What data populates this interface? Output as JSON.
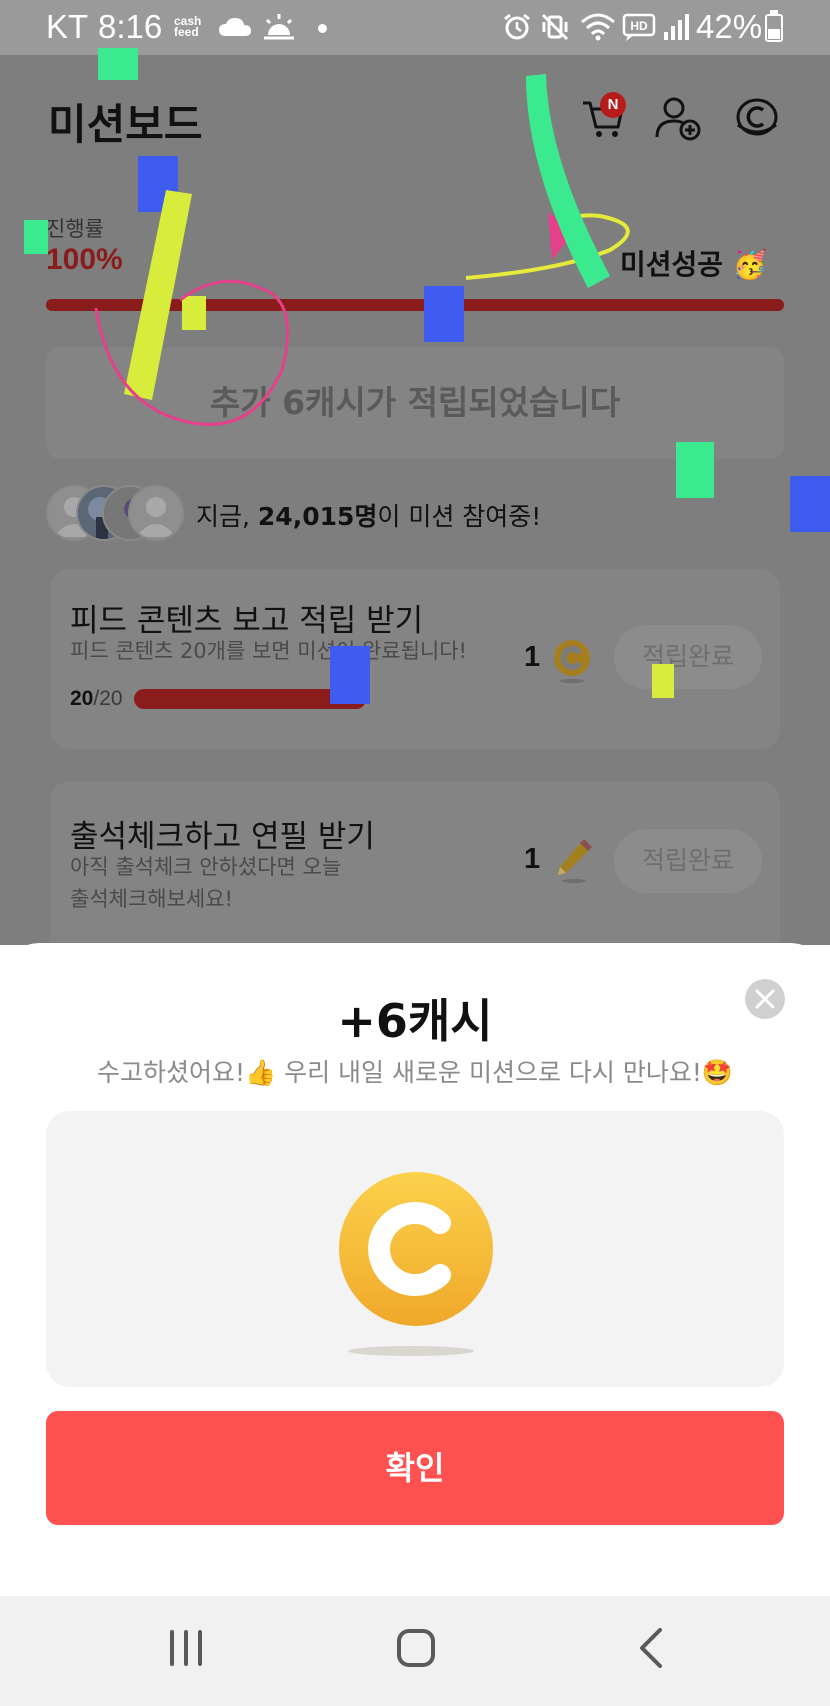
{
  "status_bar": {
    "carrier": "KT",
    "time": "8:16",
    "app_logo_line1": "cash",
    "app_logo_line2": "feed",
    "battery": "42%",
    "icons": [
      "cloud-icon",
      "sunrise-icon",
      "alarm-icon",
      "vibrate-icon",
      "wifi-icon",
      "hd-voice-icon",
      "signal-icon",
      "battery-icon"
    ]
  },
  "header": {
    "title": "미션보드",
    "cart_badge": "N",
    "icons": [
      "cart-icon",
      "add-friend-icon",
      "cash-coin-icon"
    ]
  },
  "progress": {
    "label": "진행률",
    "value_text": "100%",
    "value": 1.0,
    "success_text": "미션성공",
    "success_emoji": "🥳"
  },
  "bonus_banner": {
    "text": "추가 6캐시가 적립되었습니다"
  },
  "participants": {
    "prefix": "지금, ",
    "count": "24,015명",
    "suffix": "이 미션 참여중!"
  },
  "missions": [
    {
      "title": "피드 콘텐츠 보고 적립 받기",
      "desc": "피드 콘텐츠 20개를 보면 미션이 완료됩니다!",
      "reward": "1",
      "reward_icon": "cash-coin-icon",
      "progress_done": "20",
      "progress_total": "/20",
      "progress": 1.0,
      "button": "적립완료"
    },
    {
      "title": "출석체크하고 연필 받기",
      "desc_line1": "아직 출석체크 안하셨다면 오늘",
      "desc_line2": "출석체크해보세요!",
      "reward": "1",
      "reward_icon": "pencil-icon",
      "button": "적립완료"
    }
  ],
  "sheet": {
    "title": "+6캐시",
    "message": "수고하셨어요!👍 우리 내일 새로운 미션으로 다시 만나요!🤩",
    "confirm": "확인"
  },
  "colors": {
    "accent_red": "#ff5150",
    "progress_red": "#8b1c1c",
    "coin_gold": "#f5b82e",
    "dim_overlay": "#7e7e7e"
  },
  "nav": [
    "recent-apps-icon",
    "home-icon",
    "back-icon"
  ]
}
